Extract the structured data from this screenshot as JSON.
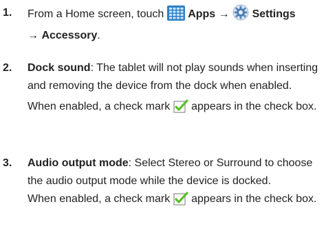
{
  "steps": [
    {
      "number": "1.",
      "line1": {
        "prefix": "From a Home screen, touch ",
        "apps_icon": "apps-grid-icon",
        "apps_label": "Apps",
        "arrow1": "→",
        "settings_icon": "settings-gear-icon",
        "settings_label": "Settings"
      },
      "line2": {
        "arrow": "→",
        "label": "Accessory",
        "suffix": "."
      }
    },
    {
      "number": "2.",
      "title": "Dock sound",
      "description": ": The tablet will not play sounds when inserting and removing the device from the dock when enabled.",
      "note_prefix": "When enabled, a check mark ",
      "note_icon": "checkbox-checked-icon",
      "note_suffix": " appears in the check box."
    },
    {
      "number": "3.",
      "title": "Audio output mode",
      "description": ": Select Stereo or Surround to choose the audio output mode while the device is docked.",
      "note_prefix": "When enabled, a check mark ",
      "note_icon": "checkbox-checked-icon",
      "note_suffix": " appears in the check box."
    }
  ]
}
